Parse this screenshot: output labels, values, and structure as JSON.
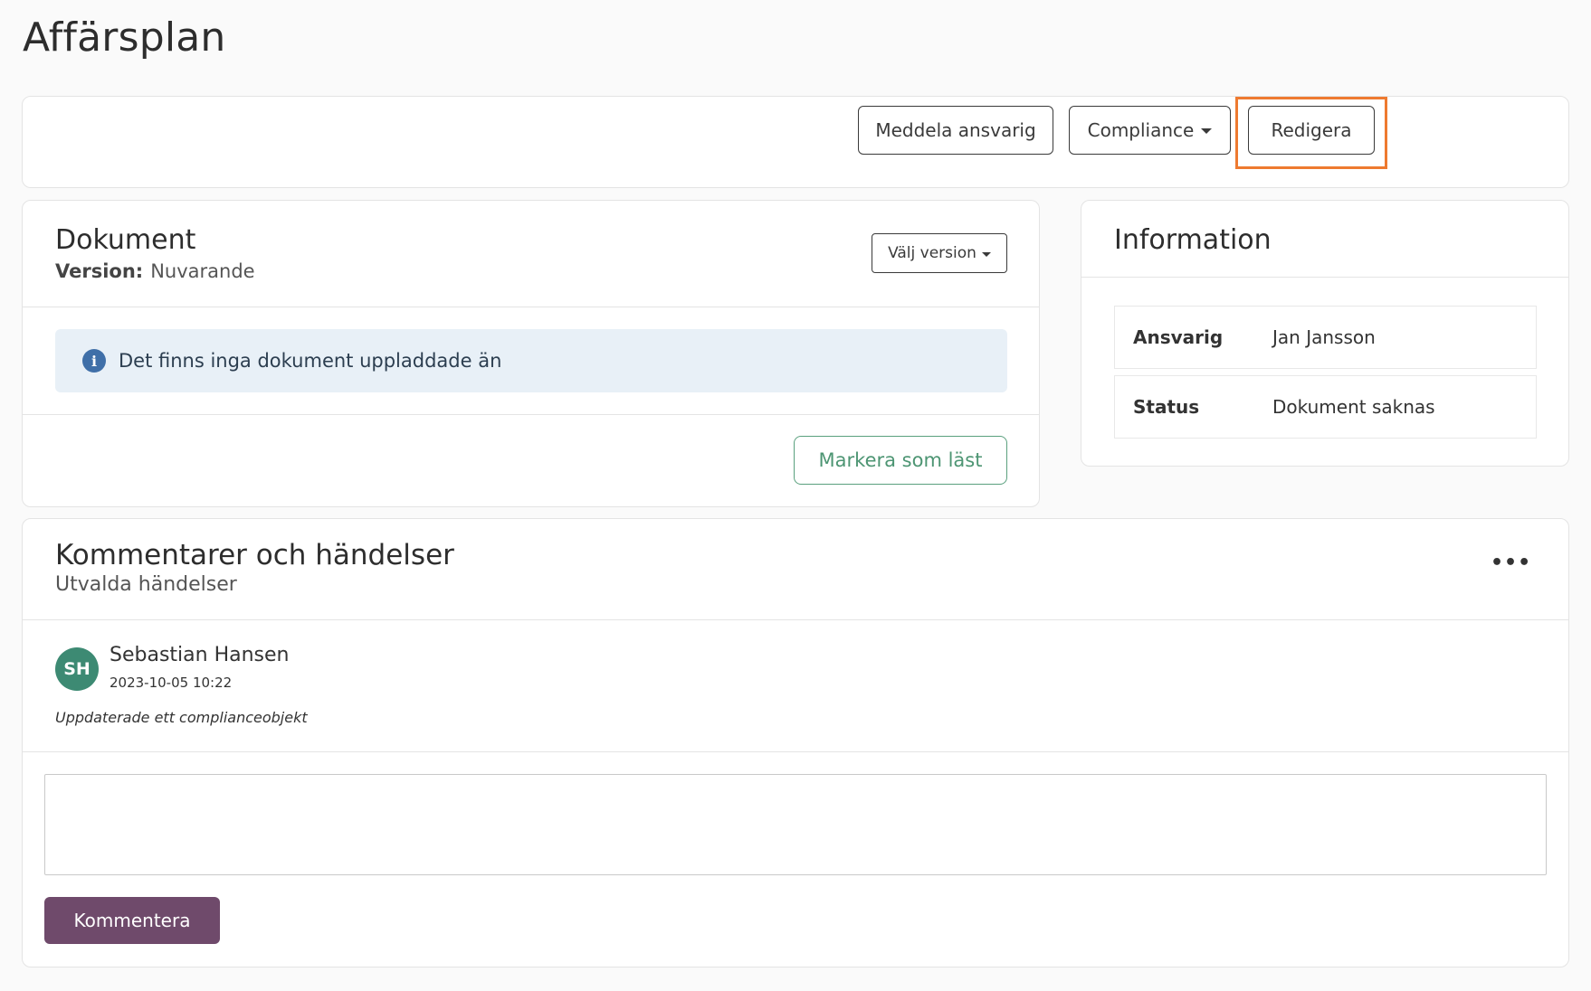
{
  "page": {
    "title": "Affärsplan"
  },
  "toolbar": {
    "notify_label": "Meddela ansvarig",
    "compliance_label": "Compliance",
    "edit_label": "Redigera"
  },
  "document": {
    "title": "Dokument",
    "version_label": "Version:",
    "version_value": "Nuvarande",
    "select_version_label": "Välj version",
    "alert_text": "Det finns inga dokument uppladdade än",
    "mark_read_label": "Markera som läst"
  },
  "information": {
    "title": "Information",
    "rows": [
      {
        "key": "Ansvarig",
        "value": "Jan Jansson"
      },
      {
        "key": "Status",
        "value": "Dokument saknas"
      }
    ]
  },
  "comments": {
    "title": "Kommentarer och händelser",
    "subtitle": "Utvalda händelser",
    "more_label": "•••",
    "entries": [
      {
        "initials": "SH",
        "author": "Sebastian Hansen",
        "timestamp": "2023-10-05 10:22",
        "text": "Uppdaterade ett complianceobjekt"
      }
    ],
    "input_value": "",
    "submit_label": "Kommentera"
  },
  "icons": {
    "info": "info-icon",
    "caret": "caret-down-icon",
    "more": "more-horizontal-icon"
  },
  "colors": {
    "highlight": "#ee7a30",
    "primary": "#6f4a6b",
    "success": "#4d9573",
    "avatar": "#3d8a73",
    "info": "#3f6fa8"
  }
}
